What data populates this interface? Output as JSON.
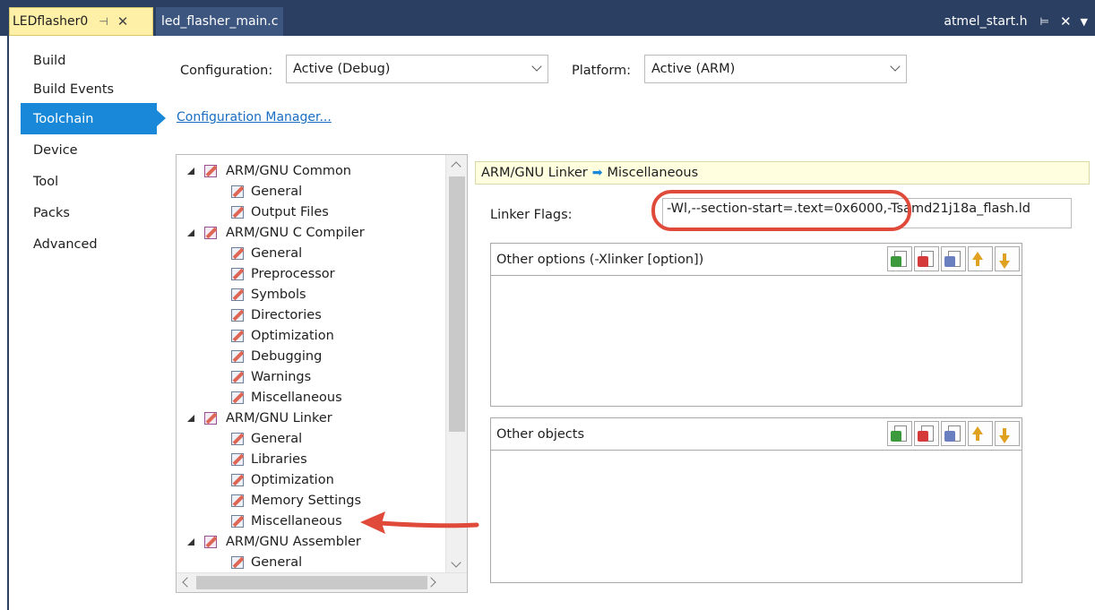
{
  "tabs": {
    "project": "LEDflasher0",
    "file": "led_flasher_main.c",
    "right": "atmel_start.h"
  },
  "nav": {
    "items": [
      "Build",
      "Build Events",
      "Toolchain",
      "Device",
      "Tool",
      "Packs",
      "Advanced"
    ],
    "selected": "Toolchain"
  },
  "config": {
    "configuration_label": "Configuration:",
    "configuration_value": "Active (Debug)",
    "platform_label": "Platform:",
    "platform_value": "Active (ARM)",
    "manager_link": "Configuration Manager..."
  },
  "tree": {
    "groups": [
      {
        "label": "ARM/GNU Common",
        "children": [
          "General",
          "Output Files"
        ]
      },
      {
        "label": "ARM/GNU C Compiler",
        "children": [
          "General",
          "Preprocessor",
          "Symbols",
          "Directories",
          "Optimization",
          "Debugging",
          "Warnings",
          "Miscellaneous"
        ]
      },
      {
        "label": "ARM/GNU Linker",
        "children": [
          "General",
          "Libraries",
          "Optimization",
          "Memory Settings",
          "Miscellaneous"
        ]
      },
      {
        "label": "ARM/GNU Assembler",
        "children": [
          "General"
        ]
      }
    ]
  },
  "panel": {
    "crumb_parent": "ARM/GNU Linker",
    "crumb_child": "Miscellaneous",
    "linker_flags_label": "Linker Flags:",
    "linker_flags_value": "-Wl,--section-start=.text=0x6000,-Tsamd21j18a_flash.ld",
    "other_options_label": "Other options (-Xlinker [option])",
    "other_objects_label": "Other objects"
  },
  "colors": {
    "accent": "#1a88d8",
    "annotation": "#e04a3a",
    "tab_active": "#fff0a8"
  }
}
